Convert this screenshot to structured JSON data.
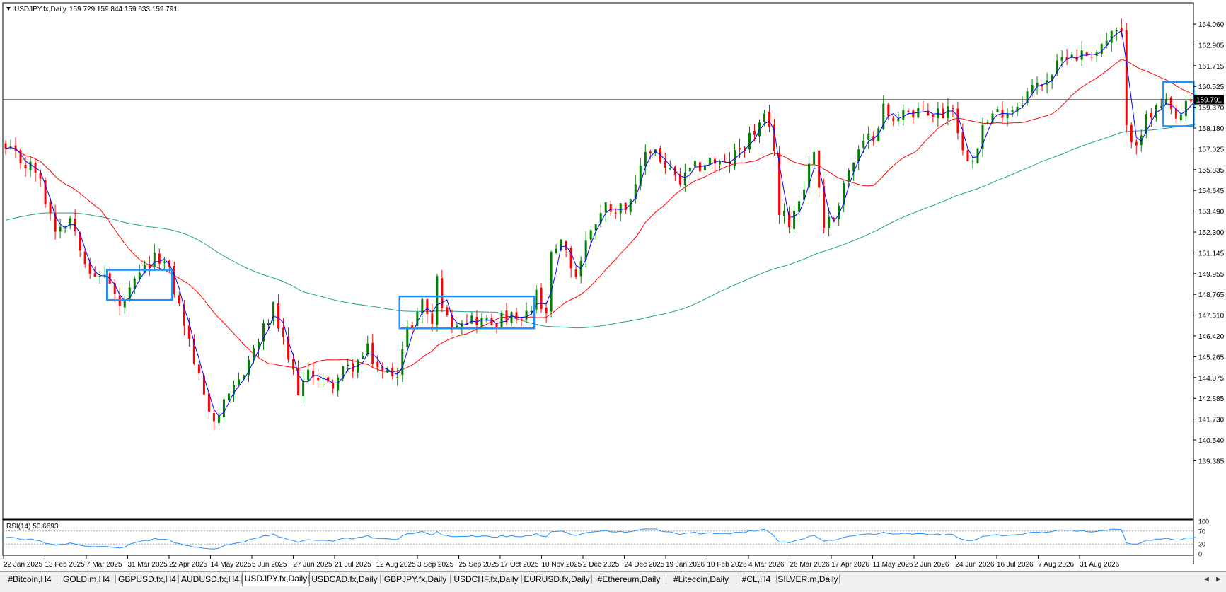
{
  "header": {
    "symbol": "USDJPY.fx,Daily",
    "ohlc": "159.729 159.844 159.633 159.791"
  },
  "rsi": {
    "label": "RSI(14) 50.6693",
    "levels": [
      "100",
      "70",
      "30",
      "0"
    ]
  },
  "current_price": "159.791",
  "colors": {
    "bull": "#008000",
    "bear": "#ff0000",
    "ma_fast": "#0000ff",
    "ma_mid": "#ff0000",
    "ma_slow": "#20a090",
    "rsi_line": "#1e90ff",
    "box": "#1e90ff"
  },
  "chart_data": {
    "type": "candlestick",
    "symbol": "USDJPY.fx",
    "timeframe": "Daily",
    "ylim": [
      139.385,
      164.6
    ],
    "yticks": [
      "164.060",
      "162.905",
      "161.715",
      "160.525",
      "159.370",
      "158.180",
      "157.025",
      "155.835",
      "154.645",
      "153.490",
      "152.300",
      "151.145",
      "149.955",
      "148.765",
      "147.610",
      "146.420",
      "145.265",
      "144.075",
      "142.885",
      "141.730",
      "140.540",
      "139.385"
    ],
    "xticks": [
      "22 Jan 2025",
      "13 Feb 2025",
      "7 Mar 2025",
      "31 Mar 2025",
      "22 Apr 2025",
      "14 May 2025",
      "5 Jun 2025",
      "27 Jun 2025",
      "21 Jul 2025",
      "12 Aug 2025",
      "3 Sep 2025",
      "25 Sep 2025",
      "17 Oct 2025",
      "10 Nov 2025",
      "2 Dec 2025",
      "24 Dec 2025",
      "19 Jan 2026",
      "10 Feb 2026",
      "4 Mar 2026",
      "26 Mar 2026",
      "17 Apr 2026",
      "11 May 2026",
      "2 Jun 2026",
      "24 Jun 2026",
      "16 Jul 2026",
      "7 Aug 2026",
      "31 Aug 2026"
    ],
    "close_path": [
      [
        0,
        156.9
      ],
      [
        6,
        155.8
      ],
      [
        10,
        152.6
      ],
      [
        13,
        153.2
      ],
      [
        18,
        149.5
      ],
      [
        20,
        150.1
      ],
      [
        23,
        148.0
      ],
      [
        28,
        150.2
      ],
      [
        31,
        151.0
      ],
      [
        33,
        150.0
      ],
      [
        36,
        147.2
      ],
      [
        39,
        144.0
      ],
      [
        42,
        141.8
      ],
      [
        45,
        142.8
      ],
      [
        48,
        144.6
      ],
      [
        51,
        146.2
      ],
      [
        54,
        148.0
      ],
      [
        56,
        146.0
      ],
      [
        59,
        143.5
      ],
      [
        62,
        144.5
      ],
      [
        65,
        143.6
      ],
      [
        68,
        144.4
      ],
      [
        71,
        145.0
      ],
      [
        73,
        145.6
      ],
      [
        76,
        144.3
      ],
      [
        79,
        144.6
      ],
      [
        81,
        146.7
      ],
      [
        84,
        148.4
      ],
      [
        86,
        147.2
      ],
      [
        87,
        149.6
      ],
      [
        89,
        147.3
      ],
      [
        92,
        147.5
      ],
      [
        95,
        147.4
      ],
      [
        98,
        147.2
      ],
      [
        101,
        147.5
      ],
      [
        104,
        147.2
      ],
      [
        106,
        147.9
      ],
      [
        107,
        149.1
      ],
      [
        108,
        147.7
      ],
      [
        109,
        147.8
      ],
      [
        110,
        150.8
      ],
      [
        112,
        151.6
      ],
      [
        115,
        149.9
      ],
      [
        118,
        152.6
      ],
      [
        121,
        153.8
      ],
      [
        124,
        153.7
      ],
      [
        127,
        154.6
      ],
      [
        129,
        156.9
      ],
      [
        131,
        157.0
      ],
      [
        133,
        155.9
      ],
      [
        136,
        155.1
      ],
      [
        139,
        155.9
      ],
      [
        142,
        156.4
      ],
      [
        145,
        156.0
      ],
      [
        148,
        157.0
      ],
      [
        151,
        158.0
      ],
      [
        153,
        158.6
      ],
      [
        155,
        157.2
      ],
      [
        156,
        153.3
      ],
      [
        158,
        153.0
      ],
      [
        160,
        154.2
      ],
      [
        163,
        157.0
      ],
      [
        165,
        152.8
      ],
      [
        167,
        153.1
      ],
      [
        169,
        155.2
      ],
      [
        172,
        156.8
      ],
      [
        175,
        157.9
      ],
      [
        177,
        159.3
      ],
      [
        179,
        158.4
      ],
      [
        181,
        159.5
      ],
      [
        183,
        158.7
      ],
      [
        185,
        159.2
      ],
      [
        187,
        159.0
      ],
      [
        189,
        159.1
      ],
      [
        191,
        159.6
      ],
      [
        193,
        156.8
      ],
      [
        195,
        156.7
      ],
      [
        197,
        158.3
      ],
      [
        199,
        158.8
      ],
      [
        201,
        159.2
      ],
      [
        203,
        159.3
      ],
      [
        206,
        160.2
      ],
      [
        209,
        160.8
      ],
      [
        212,
        161.6
      ],
      [
        214,
        162.5
      ],
      [
        216,
        162.3
      ],
      [
        218,
        162.4
      ],
      [
        220,
        162.6
      ],
      [
        222,
        163.1
      ],
      [
        224,
        163.6
      ],
      [
        225,
        163.4
      ],
      [
        226,
        158.0
      ],
      [
        228,
        157.6
      ],
      [
        230,
        158.6
      ],
      [
        232,
        159.2
      ],
      [
        234,
        159.4
      ],
      [
        236,
        158.6
      ],
      [
        238,
        159.3
      ],
      [
        240,
        159.79
      ]
    ],
    "series": [
      {
        "type": "ma",
        "period": "fast",
        "color": "blue"
      },
      {
        "type": "ma",
        "period": "medium",
        "color": "red"
      },
      {
        "type": "ma",
        "period": "slow",
        "color": "teal"
      }
    ],
    "current_price": 159.791,
    "rsi": {
      "period": 14,
      "value": 50.6693,
      "ylim": [
        0,
        100
      ],
      "levels": [
        70,
        30
      ]
    },
    "boxes": [
      {
        "from_bar": 21,
        "to_bar": 33,
        "low": 148.5,
        "high": 150.2
      },
      {
        "from_bar": 80,
        "to_bar": 106,
        "low": 146.9,
        "high": 148.7
      },
      {
        "from_bar": 234,
        "to_bar": 239,
        "low": 158.3,
        "high": 160.8
      }
    ]
  },
  "tabs": [
    {
      "label": "#Bitcoin,H4"
    },
    {
      "label": "GOLD.m,H4"
    },
    {
      "label": "GBPUSD.fx,H4"
    },
    {
      "label": "AUDUSD.fx,H4"
    },
    {
      "label": "USDJPY.fx,Daily",
      "active": true
    },
    {
      "label": "USDCAD.fx,Daily"
    },
    {
      "label": "GBPJPY.fx,Daily"
    },
    {
      "label": "USDCHF.fx,Daily"
    },
    {
      "label": "EURUSD.fx,Daily"
    },
    {
      "label": "#Ethereum,Daily"
    },
    {
      "label": "#Litecoin,Daily"
    },
    {
      "label": "#CL,H4"
    },
    {
      "label": "SILVER.m,Daily"
    }
  ],
  "nav": {
    "left": "◄",
    "right": "►"
  }
}
